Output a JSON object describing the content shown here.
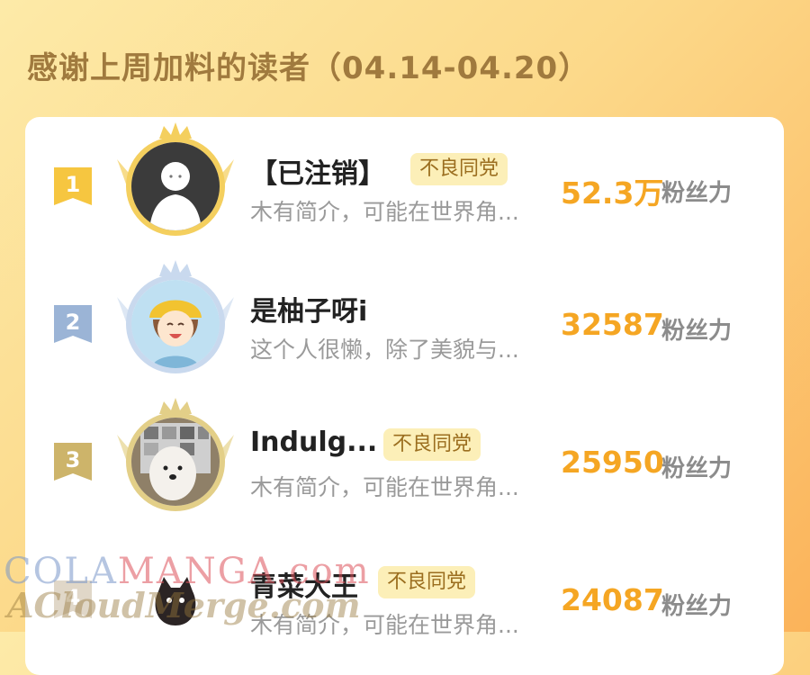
{
  "page": {
    "title": "感谢上周加料的读者（04.14-04.20）"
  },
  "readers": [
    {
      "rank": "1",
      "name": "【已注销】",
      "tag": "不良同党",
      "description": "木有简介，可能在世界角...",
      "score": "52.3万",
      "unit": "粉丝力",
      "rank_color": "#f6c640",
      "frame_color": "#f4cf5e"
    },
    {
      "rank": "2",
      "name": "是柚子呀i",
      "tag": "",
      "description": "这个人很懒，除了美貌与...",
      "score": "32587",
      "unit": "粉丝力",
      "rank_color": "#9bb4d6",
      "frame_color": "#c9d9ee"
    },
    {
      "rank": "3",
      "name": "Indulg...",
      "tag": "不良同党",
      "description": "木有简介，可能在世界角...",
      "score": "25950",
      "unit": "粉丝力",
      "rank_color": "#cdb46a",
      "frame_color": "#e3cf88"
    },
    {
      "rank": "4",
      "name": "青菜大王",
      "tag": "不良同党",
      "description": "木有简介，可能在世界角...",
      "score": "24087",
      "unit": "粉丝力",
      "rank_color": "#e0d7c8",
      "frame_color": "#ffffff"
    }
  ],
  "watermark": {
    "line1_a": "COLA",
    "line1_b": "MANGA",
    "line1_c": ".com",
    "line2": "ACloudMerge.com"
  }
}
